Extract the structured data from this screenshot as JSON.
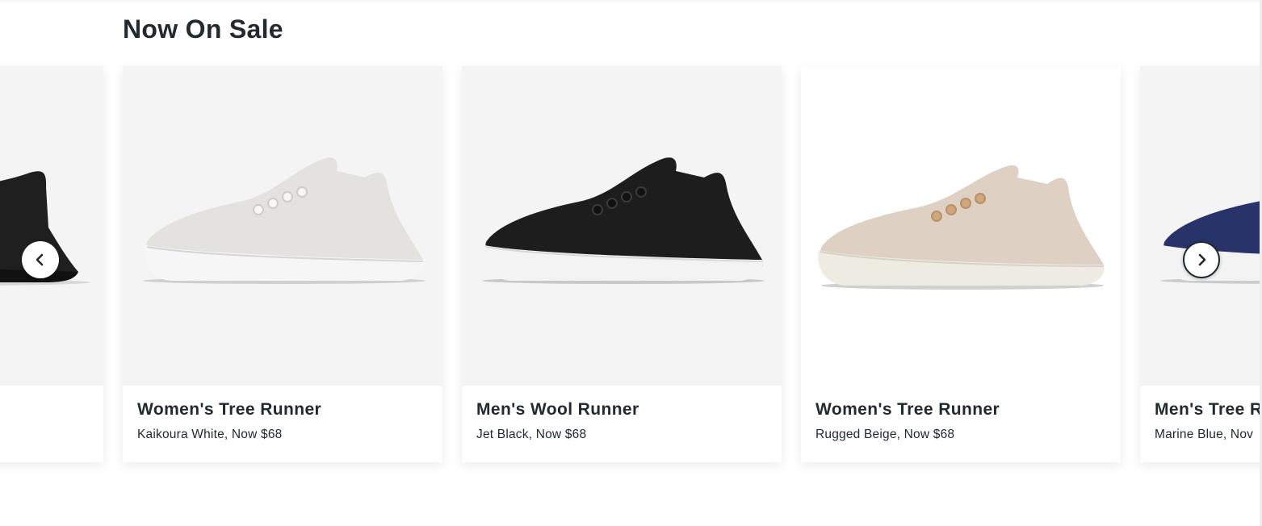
{
  "section": {
    "title": "Now On Sale"
  },
  "colors": {
    "text": "#212a2f",
    "image_bg": "#f4f4f4",
    "card_bg": "#ffffff"
  },
  "carousel": {
    "prev_icon": "chevron-left-icon",
    "next_icon": "chevron-right-icon",
    "cards": [
      {
        "name": "",
        "subtitle": "",
        "shoe_color": "black",
        "sole_color": "black",
        "partial": "left"
      },
      {
        "name": "Women's Tree Runner",
        "subtitle": "Kaikoura White, Now $68",
        "shoe_color": "off-white",
        "sole_color": "white"
      },
      {
        "name": "Men's Wool Runner",
        "subtitle": "Jet Black, Now $68",
        "shoe_color": "black",
        "sole_color": "white"
      },
      {
        "name": "Women's Tree Runner",
        "subtitle": "Rugged Beige, Now $68",
        "shoe_color": "beige",
        "sole_color": "cream"
      },
      {
        "name": "Men's Tree R",
        "subtitle": "Marine Blue, Nov",
        "shoe_color": "navy",
        "sole_color": "white",
        "partial": "right"
      }
    ]
  }
}
